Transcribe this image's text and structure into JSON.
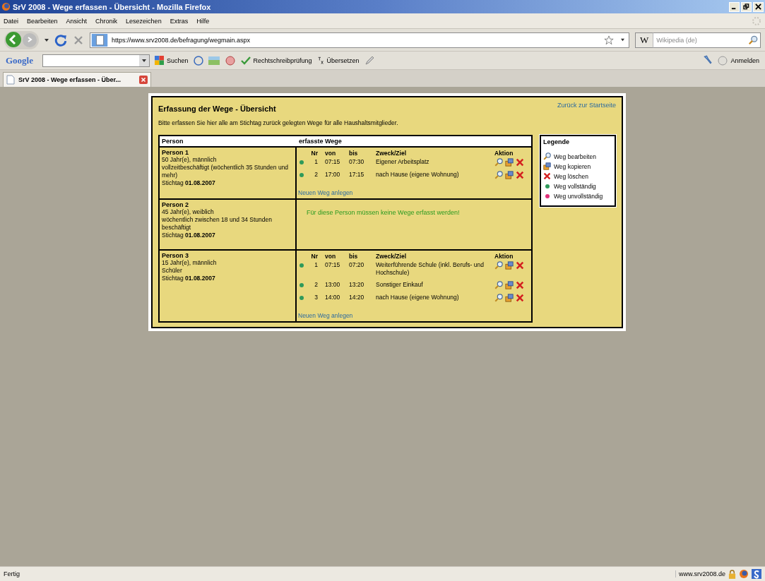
{
  "window": {
    "title": "SrV 2008 - Wege erfassen - Übersicht - Mozilla Firefox"
  },
  "menu": [
    "Datei",
    "Bearbeiten",
    "Ansicht",
    "Chronik",
    "Lesezeichen",
    "Extras",
    "Hilfe"
  ],
  "nav": {
    "url": "https://www.srv2008.de/befragung/wegmain.aspx",
    "search_engine": "W",
    "search_placeholder": "Wikipedia (de)"
  },
  "google_bar": {
    "logo": "Google",
    "search": "Suchen",
    "spellcheck": "Rechtschreibprüfung",
    "translate": "Übersetzen",
    "signin": "Anmelden"
  },
  "tabs": [
    {
      "label": "SrV 2008 - Wege erfassen - Über...",
      "selected": true
    }
  ],
  "page": {
    "title": "Erfassung der Wege - Übersicht",
    "back_link": "Zurück zur Startseite",
    "intro": "Bitte erfassen Sie hier alle am Stichtag zurück gelegten Wege für alle Haushaltsmitglieder.",
    "columns": [
      "Person",
      "erfasste Wege"
    ],
    "persons": [
      {
        "name": "Person 1",
        "lines": [
          "50 Jahr(e), männlich",
          "vollzeitbeschäftigt (wöchentlich 35 Stunden und mehr)"
        ],
        "date": "Stichtag **01.08.2007**",
        "trip_columns": [
          "Nr",
          "von",
          "bis",
          "Zweck/Ziel",
          "Aktion"
        ],
        "trips": [
          {
            "nr": "1",
            "from": "07:15",
            "to": "07:30",
            "purpose": "Eigener Arbeitsplatz",
            "complete": true
          },
          {
            "nr": "2",
            "from": "17:00",
            "to": "17:15",
            "purpose": "nach Hause (eigene Wohnung)",
            "complete": true
          }
        ],
        "new_link": "Neuen Weg anlegen"
      },
      {
        "name": "Person 2",
        "lines": [
          "45 Jahr(e), weiblich",
          "wöchentlich zwischen 18 und 34 Stunden beschäftigt"
        ],
        "date": "Stichtag **01.08.2007**",
        "note": "Für diese Person müssen keine Wege erfasst werden!"
      },
      {
        "name": "Person 3",
        "lines": [
          "15 Jahr(e), männlich",
          "Schüler"
        ],
        "date": "Stichtag **01.08.2007**",
        "trip_columns": [
          "Nr",
          "von",
          "bis",
          "Zweck/Ziel",
          "Aktion"
        ],
        "trips": [
          {
            "nr": "1",
            "from": "07:15",
            "to": "07:20",
            "purpose": "Weiterführende Schule (inkl. Berufs- und Hochschule)",
            "complete": true
          },
          {
            "nr": "2",
            "from": "13:00",
            "to": "13:20",
            "purpose": "Sonstiger Einkauf",
            "complete": true
          },
          {
            "nr": "3",
            "from": "14:00",
            "to": "14:20",
            "purpose": "nach Hause (eigene Wohnung)",
            "complete": true
          }
        ],
        "new_link": "Neuen Weg anlegen"
      }
    ],
    "legend": {
      "title": "Legende",
      "items": [
        {
          "kind": "edit",
          "label": "Weg bearbeiten"
        },
        {
          "kind": "copy",
          "label": "Weg kopieren"
        },
        {
          "kind": "delete",
          "label": "Weg löschen"
        },
        {
          "kind": "complete",
          "label": "Weg vollständig"
        },
        {
          "kind": "incomplete",
          "label": "Weg unvollständig"
        }
      ]
    }
  },
  "status_bar": {
    "text": "Fertig",
    "domain": "www.srv2008.de"
  }
}
